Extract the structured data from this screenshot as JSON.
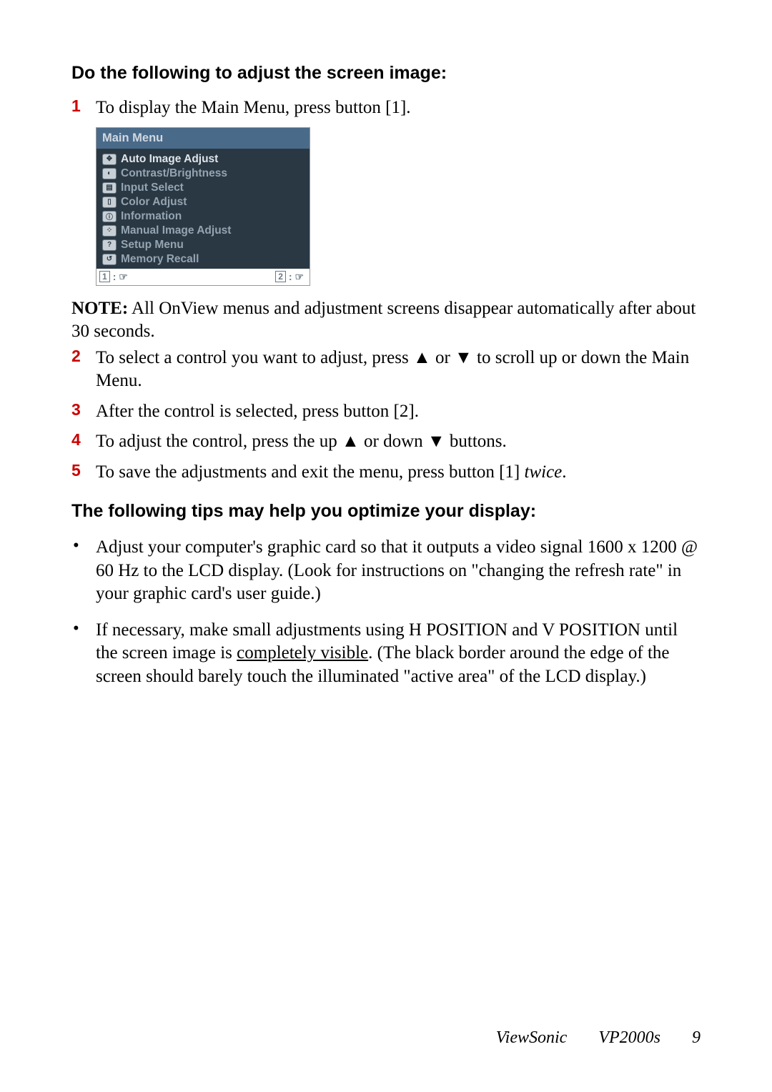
{
  "heading1": "Do the following to adjust the screen image:",
  "step1": {
    "num": "1",
    "text": "To display the Main Menu, press button [1]."
  },
  "osd": {
    "title": "Main Menu",
    "items": [
      {
        "icon": "✥",
        "label": "Auto Image Adjust"
      },
      {
        "icon": "◐",
        "label": "Contrast/Brightness"
      },
      {
        "icon": "▤",
        "label": "Input Select"
      },
      {
        "icon": "▯",
        "label": "Color Adjust"
      },
      {
        "icon": "ⓘ",
        "label": "Information"
      },
      {
        "icon": "⁘",
        "label": "Manual Image Adjust"
      },
      {
        "icon": "?",
        "label": "Setup Menu"
      },
      {
        "icon": "↺",
        "label": "Memory Recall"
      }
    ],
    "footer": {
      "left_num": "1",
      "left_sym": ": ☞",
      "right_num": "2",
      "right_sym": ": ☞"
    }
  },
  "note": {
    "label": "NOTE:",
    "text": " All OnView menus and adjustment screens disappear automatically after about 30 seconds."
  },
  "step2": {
    "num": "2",
    "text": "To select a control you want to adjust, press ▲ or ▼ to scroll up or down the Main Menu."
  },
  "step3": {
    "num": "3",
    "text": "After the control is selected, press button [2]."
  },
  "step4": {
    "num": "4",
    "text": "To adjust the control, press the up ▲ or down ▼ buttons."
  },
  "step5": {
    "num": "5",
    "text_a": "To save the adjustments and exit the menu, press button [1] ",
    "text_b": "twice",
    "text_c": "."
  },
  "heading2": "The following tips may help you optimize your display:",
  "tip1": "Adjust your computer's graphic card so that it outputs a video signal 1600 x 1200 @ 60 Hz to the LCD display. (Look for instructions on \"changing the refresh rate\" in your graphic card's user guide.)",
  "tip2": {
    "a": "If necessary, make small adjustments using H POSITION and V POSITION until the screen image is ",
    "b": "completely visible",
    "c": ". (The black border around the edge of the screen should barely touch the illuminated \"active area\" of the LCD display.)"
  },
  "footer": {
    "brand": "ViewSonic",
    "model": "VP2000s",
    "page": "9"
  }
}
